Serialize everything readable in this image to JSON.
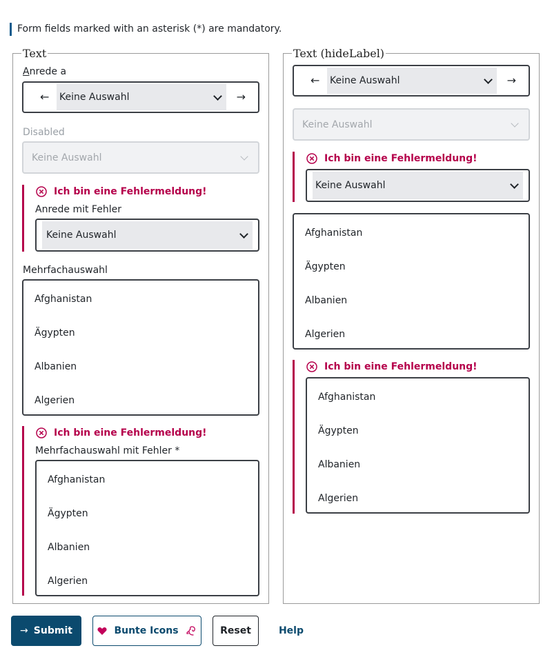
{
  "notice": "Form fields marked with an asterisk (*) are mandatory.",
  "left": {
    "legend": "Text",
    "salutation": {
      "label_access": "A",
      "label_rest": "nrede a",
      "value": "Keine Auswahl"
    },
    "disabled": {
      "label": "Disabled",
      "value": "Keine Auswahl"
    },
    "error_select": {
      "error": "Ich bin eine Fehlermeldung!",
      "label": "Anrede mit Fehler",
      "value": "Keine Auswahl"
    },
    "multi": {
      "label": "Mehrfachauswahl",
      "options": [
        "Afghanistan",
        "Ägypten",
        "Albanien",
        "Algerien"
      ]
    },
    "error_multi": {
      "error": "Ich bin eine Fehlermeldung!",
      "label": "Mehrfachauswahl mit Fehler",
      "required_mark": "*",
      "options": [
        "Afghanistan",
        "Ägypten",
        "Albanien",
        "Algerien"
      ]
    }
  },
  "right": {
    "legend": "Text (hideLabel)",
    "salutation": {
      "value": "Keine Auswahl"
    },
    "disabled": {
      "value": "Keine Auswahl"
    },
    "error_select": {
      "error": "Ich bin eine Fehlermeldung!",
      "value": "Keine Auswahl"
    },
    "multi": {
      "options": [
        "Afghanistan",
        "Ägypten",
        "Albanien",
        "Algerien"
      ]
    },
    "error_multi": {
      "error": "Ich bin eine Fehlermeldung!",
      "options": [
        "Afghanistan",
        "Ägypten",
        "Albanien",
        "Algerien"
      ]
    }
  },
  "buttons": {
    "submit": "Submit",
    "icons": "Bunte Icons",
    "reset": "Reset",
    "help": "Help"
  },
  "icons": {
    "arrow_left": "arrow-left-icon",
    "arrow_right": "arrow-right-icon",
    "chevron": "chevron-down-icon",
    "error": "error-circle-icon",
    "heart": "heart-icon",
    "squirrel": "squirrel-icon"
  },
  "colors": {
    "primary": "#0b4a6e",
    "error": "#b5004b",
    "border": "#3b3f45"
  }
}
